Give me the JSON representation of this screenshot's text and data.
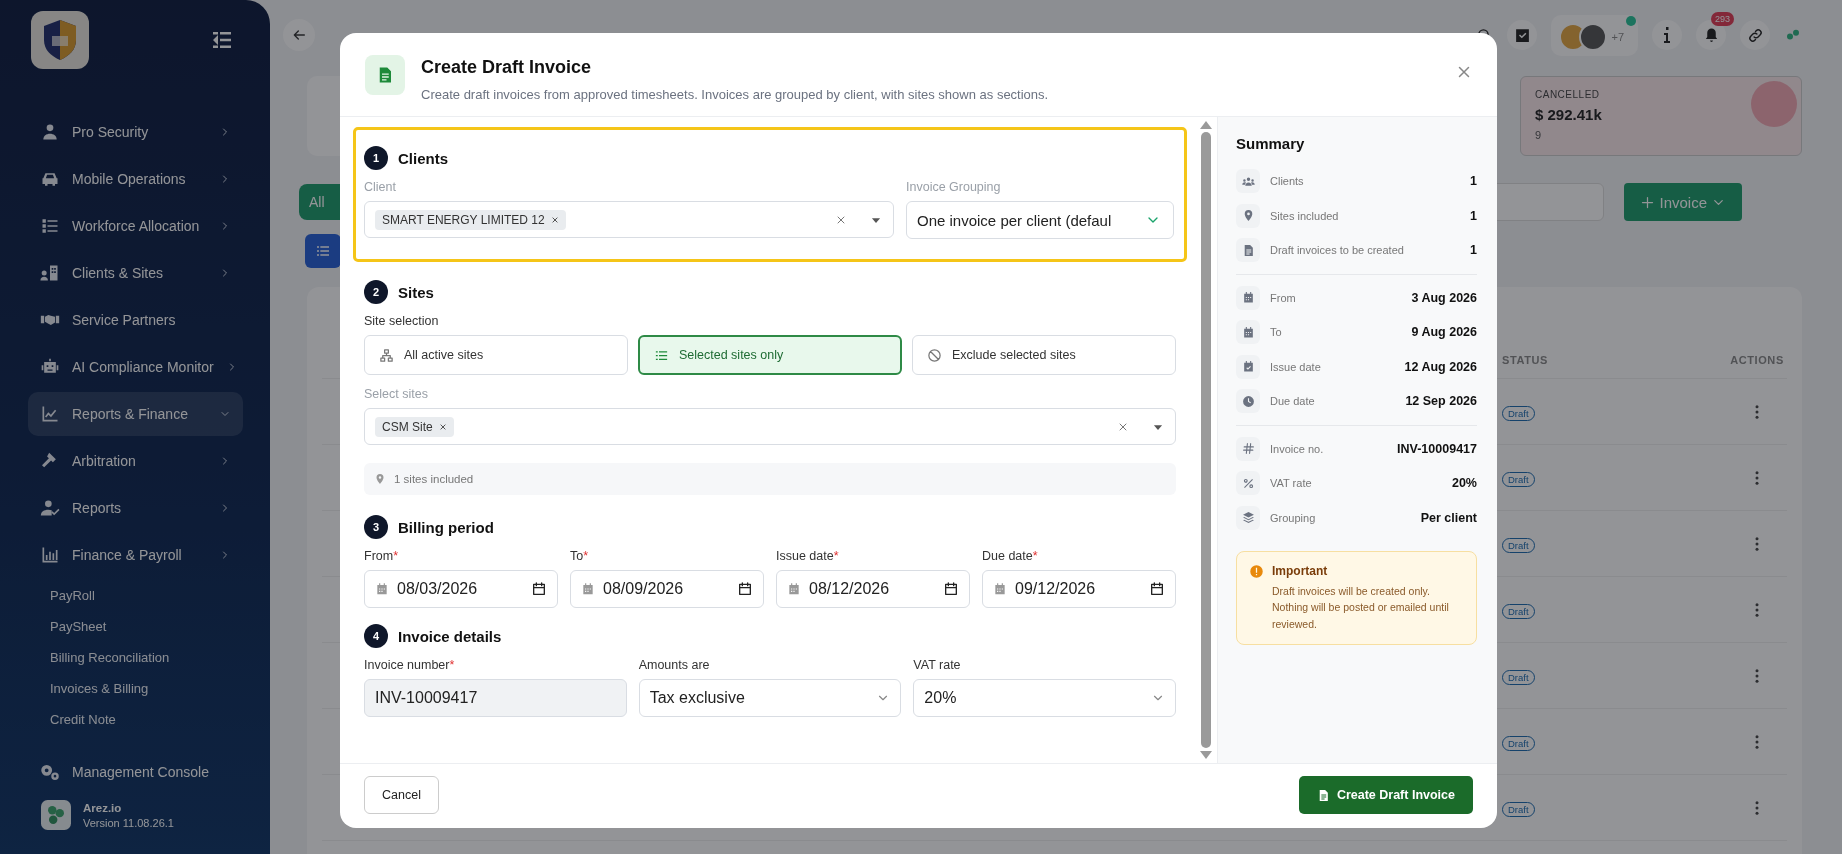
{
  "sidebar": {
    "items": [
      {
        "label": "Pro Security",
        "chevron": true,
        "expanded": false
      },
      {
        "label": "Mobile Operations",
        "chevron": true,
        "expanded": false
      },
      {
        "label": "Workforce Allocation",
        "chevron": true,
        "expanded": false
      },
      {
        "label": "Clients & Sites",
        "chevron": true,
        "expanded": false
      },
      {
        "label": "Service Partners",
        "chevron": false,
        "expanded": false
      },
      {
        "label": "AI Compliance Monitor",
        "chevron": true,
        "expanded": false
      },
      {
        "label": "Reports & Finance",
        "chevron": true,
        "expanded": true
      },
      {
        "label": "Arbitration",
        "chevron": true,
        "expanded": false
      },
      {
        "label": "Reports",
        "chevron": true,
        "expanded": false
      },
      {
        "label": "Finance & Payroll",
        "chevron": true,
        "expanded": false
      }
    ],
    "sub_items": [
      "PayRoll",
      "PaySheet",
      "Billing Reconciliation",
      "Invoices & Billing",
      "Credit Note"
    ],
    "bottom_item": "Management Console",
    "app": {
      "name": "Arez.io",
      "version": "Version 11.08.26.1"
    }
  },
  "background": {
    "avatar_more": "+7",
    "notification_count": "293",
    "cancelled_card": {
      "label": "CANCELLED",
      "amount": "$ 292.41k",
      "count": "9"
    },
    "filter_button": "All",
    "new_button": "Invoice",
    "table": {
      "columns": [
        "STATUS",
        "ACTIONS"
      ],
      "rows": [
        {
          "status": "Draft"
        },
        {
          "status": "Draft"
        },
        {
          "status": "Draft"
        },
        {
          "status": "Draft"
        },
        {
          "status": "Draft"
        },
        {
          "status": "Draft"
        },
        {
          "status": "Draft"
        }
      ]
    }
  },
  "modal": {
    "title": "Create Draft Invoice",
    "subtitle": "Create draft invoices from approved timesheets. Invoices are grouped by client, with sites shown as sections.",
    "clients": {
      "number": "1",
      "title": "Clients",
      "highlighted": true,
      "client_label": "Client",
      "clients": [
        "SMART ENERGY LIMITED 12"
      ],
      "grouping_label": "Invoice Grouping",
      "grouping_value": "One invoice per client (defaul"
    },
    "sites": {
      "number": "2",
      "title": "Sites",
      "selection_label": "Site selection",
      "options": [
        {
          "label": "All active sites",
          "selected": false
        },
        {
          "label": "Selected sites only",
          "selected": true
        },
        {
          "label": "Exclude selected sites",
          "selected": false
        }
      ],
      "select_label": "Select sites",
      "sites": [
        "CSM Site"
      ],
      "info": "1 sites included"
    },
    "billing": {
      "number": "3",
      "title": "Billing period",
      "fields": [
        {
          "label": "From",
          "mark": "*",
          "value": "08/03/2026"
        },
        {
          "label": "To",
          "mark": "*",
          "value": "08/09/2026"
        },
        {
          "label": "Issue date",
          "mark": "*",
          "value": "08/12/2026"
        },
        {
          "label": "Due date",
          "mark": "*",
          "value": "09/12/2026"
        }
      ]
    },
    "details": {
      "number": "4",
      "title": "Invoice details",
      "fields": [
        {
          "kind": "text",
          "label": "Invoice number",
          "mark": "*",
          "value": "INV-10009417"
        },
        {
          "kind": "select",
          "label": "Amounts are",
          "value": "Tax exclusive"
        },
        {
          "kind": "select",
          "label": "VAT rate",
          "value": "20%"
        }
      ]
    },
    "summary": {
      "title": "Summary",
      "groups": [
        [
          {
            "label": "Clients",
            "value": "1"
          },
          {
            "label": "Sites included",
            "value": "1"
          },
          {
            "label": "Draft invoices to be created",
            "value": "1"
          }
        ],
        [
          {
            "label": "From",
            "value": "3 Aug 2026"
          },
          {
            "label": "To",
            "value": "9 Aug 2026"
          },
          {
            "label": "Issue date",
            "value": "12 Aug 2026"
          },
          {
            "label": "Due date",
            "value": "12 Sep 2026"
          }
        ],
        [
          {
            "label": "Invoice no.",
            "value": "INV-10009417"
          },
          {
            "label": "VAT rate",
            "value": "20%"
          },
          {
            "label": "Grouping",
            "value": "Per client"
          }
        ]
      ],
      "notice": {
        "title": "Important",
        "text": "Draft invoices will be created only. Nothing will be posted or emailed until reviewed."
      }
    },
    "cancel_button": "Cancel",
    "create_button": "Create Draft Invoice"
  }
}
